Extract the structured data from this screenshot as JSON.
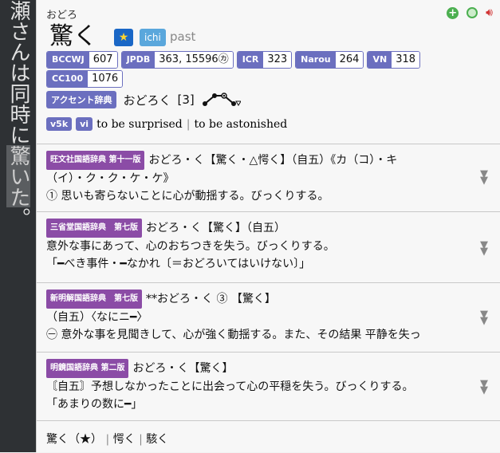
{
  "sidebar": {
    "text_before": "瀬さんは同時に",
    "text_highlight": "驚いた",
    "text_after": "。"
  },
  "entry": {
    "reading": "おどろ",
    "term": "驚く",
    "tags": {
      "star": "★",
      "ichi": "ichi",
      "past": "past"
    }
  },
  "frequencies": [
    {
      "label": "BCCWJ",
      "value": "607"
    },
    {
      "label": "JPDB",
      "value": "363, 15596㋕"
    },
    {
      "label": "ICR",
      "value": "323"
    },
    {
      "label": "Narou",
      "value": "264"
    },
    {
      "label": "VN",
      "value": "318"
    },
    {
      "label": "CC100",
      "value": "1076"
    }
  ],
  "accent": {
    "label": "アクセント辞典",
    "word": "おどろく",
    "num": "[3]"
  },
  "definition": {
    "tags": [
      "v5k",
      "vi"
    ],
    "gloss1": "to be surprised",
    "sep": "|",
    "gloss2": "to be astonished"
  },
  "dictionaries": [
    {
      "tag": "旺文社国語辞典 第十一版",
      "line1": "おどろ・く【驚く・△愕く】（自五）《カ（コ）・キ",
      "line2": "（イ）・ク・ク・ケ・ケ》",
      "line3": "① 思いも寄らないことに心が動揺する。びっくりする。"
    },
    {
      "tag": "三省堂国語辞典　第七版",
      "line1": "おどろ・く【驚く】（自五）",
      "line2": "意外な事にあって、心のおちつきを失う。びっくりする。",
      "line3": "「━べき事件・━なかれ〔＝おどろいてはいけない〕」"
    },
    {
      "tag": "新明解国語辞典　第七版",
      "line1": "**おどろ・く ③ 【驚く】",
      "line2": "（自五）〈なにニ━〉",
      "line3": "㊀ 意外な事を見聞きして、心が強く動揺する。また、その結果 平静を失っ"
    },
    {
      "tag": "明鏡国語辞典 第二版",
      "line1": "おどろ・く【驚く】",
      "line2": "〘自五〙予想しなかったことに出会って心の平穏を失う。びっくりする。",
      "line3": "「あまりの数に━」"
    }
  ],
  "footer": {
    "a": "驚く（★）",
    "sep1": "|",
    "b": "愕く",
    "sep2": "|",
    "c": "駭く"
  }
}
